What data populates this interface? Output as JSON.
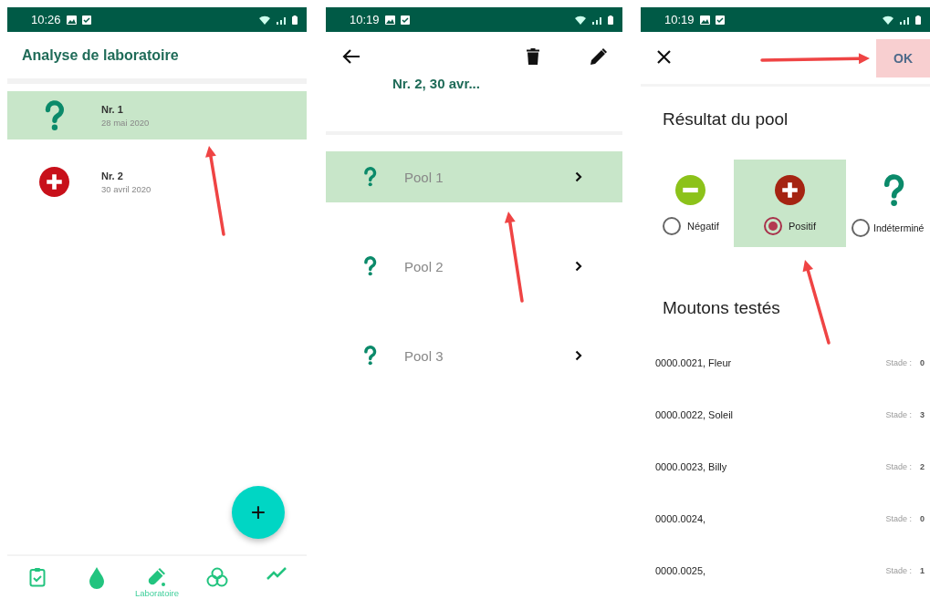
{
  "screens": [
    {
      "kind": "list",
      "status_bar": {
        "time": "10:26"
      },
      "title": "Analyse de laboratoire",
      "items": [
        {
          "kind": "unknown",
          "name": "Nr. 1",
          "date": "28 mai 2020",
          "selected": true
        },
        {
          "kind": "positive",
          "name": "Nr. 2",
          "date": "30 avril 2020",
          "selected": false
        }
      ],
      "fab": "+",
      "nav": [
        {
          "kind": "clipboard"
        },
        {
          "kind": "drop"
        },
        {
          "kind": "test-tube",
          "label": "Laboratoire"
        },
        {
          "kind": "biohazard"
        },
        {
          "kind": "chart"
        }
      ]
    },
    {
      "kind": "detail",
      "status_bar": {
        "time": "10:19"
      },
      "title": "Nr. 2, 30 avr...",
      "pools": [
        {
          "kind": "unknown",
          "label": "Pool 1",
          "selected": true
        },
        {
          "kind": "unknown",
          "label": "Pool 2",
          "selected": false
        },
        {
          "kind": "unknown",
          "label": "Pool 3",
          "selected": false
        }
      ]
    },
    {
      "kind": "form",
      "status_bar": {
        "time": "10:19"
      },
      "ok": "OK",
      "section_title": "Résultat du pool",
      "options": [
        {
          "kind": "negative",
          "label": "Négatif",
          "selected": false
        },
        {
          "kind": "positive",
          "label": "Positif",
          "selected": true
        },
        {
          "kind": "unknown",
          "label": "Indéterminé",
          "selected": false
        }
      ],
      "sheep_title": "Moutons testés",
      "sheep": [
        {
          "name": "0000.0021, Fleur",
          "stage_label": "Stade :",
          "stage": "0"
        },
        {
          "name": "0000.0022, Soleil",
          "stage_label": "Stade :",
          "stage": "3"
        },
        {
          "name": "0000.0023, Billy",
          "stage_label": "Stade :",
          "stage": "2"
        },
        {
          "name": "0000.0024,",
          "stage_label": "Stade :",
          "stage": "0"
        },
        {
          "name": "0000.0025,",
          "stage_label": "Stade :",
          "stage": "1"
        }
      ]
    }
  ]
}
